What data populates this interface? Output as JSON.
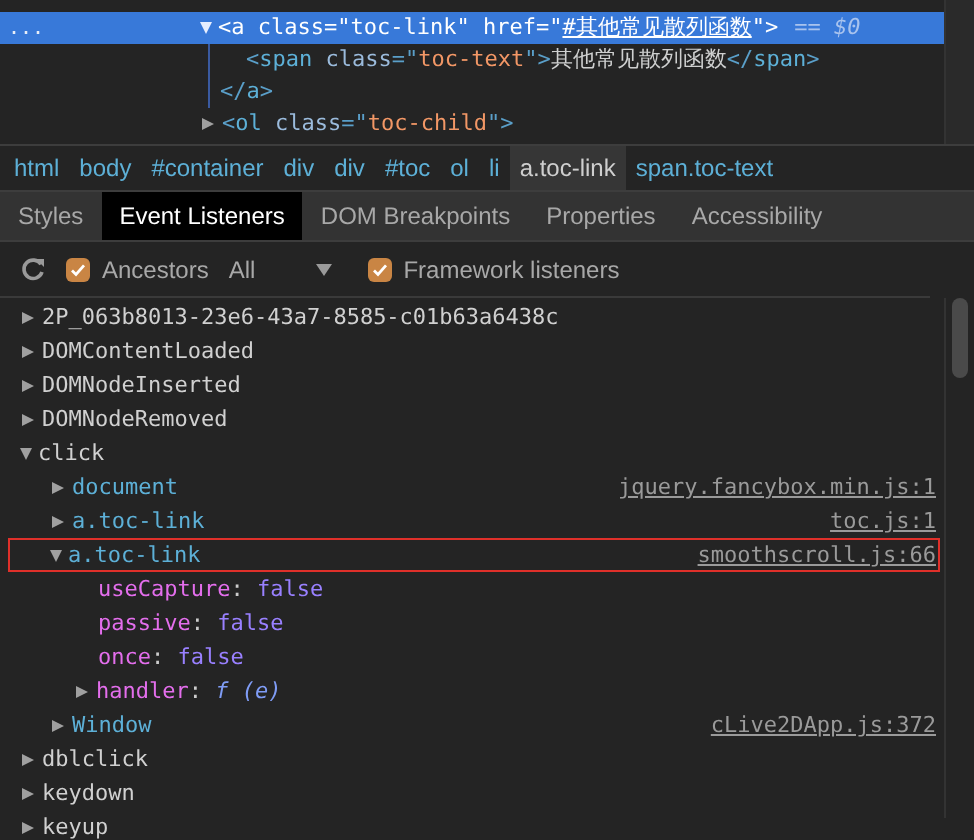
{
  "dom_tree": [
    {
      "selected": true,
      "expanded": true,
      "ellipsis": "...",
      "open_tag": [
        {
          "kind": "punct",
          "text": "<"
        },
        {
          "kind": "tag",
          "text": "a"
        },
        {
          "kind": "attr",
          "text": " class"
        },
        {
          "kind": "punct",
          "text": "=\""
        },
        {
          "kind": "value",
          "text": "toc-link"
        },
        {
          "kind": "punct",
          "text": "\""
        },
        {
          "kind": "attr",
          "text": " href"
        },
        {
          "kind": "punct",
          "text": "=\""
        },
        {
          "kind": "link",
          "text": "#其他常见散列函数"
        },
        {
          "kind": "punct",
          "text": "\">"
        }
      ],
      "suffix": "== $0",
      "children": [
        {
          "open_tag": [
            {
              "kind": "punct",
              "text": "<"
            },
            {
              "kind": "tag",
              "text": "span"
            },
            {
              "kind": "attr",
              "text": " class"
            },
            {
              "kind": "punct",
              "text": "=\""
            },
            {
              "kind": "value",
              "text": "toc-text"
            },
            {
              "kind": "punct",
              "text": "\">"
            },
            {
              "kind": "text",
              "text": "其他常见散列函数"
            },
            {
              "kind": "punct",
              "text": "</"
            },
            {
              "kind": "tag",
              "text": "span"
            },
            {
              "kind": "punct",
              "text": ">"
            }
          ]
        }
      ],
      "close_tag": [
        {
          "kind": "punct",
          "text": "</"
        },
        {
          "kind": "tag",
          "text": "a"
        },
        {
          "kind": "punct",
          "text": ">"
        }
      ]
    },
    {
      "selected": false,
      "expanded": false,
      "open_tag": [
        {
          "kind": "punct",
          "text": "<"
        },
        {
          "kind": "tag",
          "text": "ol"
        },
        {
          "kind": "attr",
          "text": " class"
        },
        {
          "kind": "punct",
          "text": "=\""
        },
        {
          "kind": "value",
          "text": "toc-child"
        },
        {
          "kind": "punct",
          "text": "\">"
        }
      ]
    }
  ],
  "breadcrumbs": [
    {
      "label": "html",
      "selected": false
    },
    {
      "label": "body",
      "selected": false
    },
    {
      "label": "#container",
      "selected": false
    },
    {
      "label": "div",
      "selected": false
    },
    {
      "label": "div",
      "selected": false
    },
    {
      "label": "#toc",
      "selected": false
    },
    {
      "label": "ol",
      "selected": false
    },
    {
      "label": "li",
      "selected": false
    },
    {
      "label": "a.toc-link",
      "selected": true
    },
    {
      "label": "span.toc-text",
      "selected": false
    }
  ],
  "tabs": [
    {
      "label": "Styles",
      "selected": false
    },
    {
      "label": "Event Listeners",
      "selected": true
    },
    {
      "label": "DOM Breakpoints",
      "selected": false
    },
    {
      "label": "Properties",
      "selected": false
    },
    {
      "label": "Accessibility",
      "selected": false
    }
  ],
  "toolbar": {
    "ancestors": {
      "label": "Ancestors",
      "checked": true
    },
    "filter": {
      "value": "All"
    },
    "framework": {
      "label": "Framework listeners",
      "checked": true
    }
  },
  "listeners": [
    {
      "name": "2P_063b8013-23e6-43a7-8585-c01b63a6438c",
      "expanded": false
    },
    {
      "name": "DOMContentLoaded",
      "expanded": false
    },
    {
      "name": "DOMNodeInserted",
      "expanded": false
    },
    {
      "name": "DOMNodeRemoved",
      "expanded": false
    },
    {
      "name": "click",
      "expanded": true,
      "children": [
        {
          "target": "document",
          "source": "jquery.fancybox.min.js:1",
          "expanded": false,
          "highlighted": false
        },
        {
          "target": "a.toc-link",
          "source": "toc.js:1",
          "expanded": false,
          "highlighted": false
        },
        {
          "target": "a.toc-link",
          "source": "smoothscroll.js:66",
          "expanded": true,
          "highlighted": true,
          "properties": [
            {
              "key": "useCapture",
              "separator": ": ",
              "value": "false",
              "kind": "boolean"
            },
            {
              "key": "passive",
              "separator": ": ",
              "value": "false",
              "kind": "boolean"
            },
            {
              "key": "once",
              "separator": ": ",
              "value": "false",
              "kind": "boolean"
            },
            {
              "key": "handler",
              "separator": ": ",
              "value": "f (e)",
              "kind": "function",
              "expanded": false
            }
          ]
        },
        {
          "target": "Window",
          "source": "cLive2DApp.js:372",
          "expanded": false,
          "highlighted": false
        }
      ]
    },
    {
      "name": "dblclick",
      "expanded": false
    },
    {
      "name": "keydown",
      "expanded": false
    },
    {
      "name": "keyup",
      "expanded": false
    }
  ]
}
